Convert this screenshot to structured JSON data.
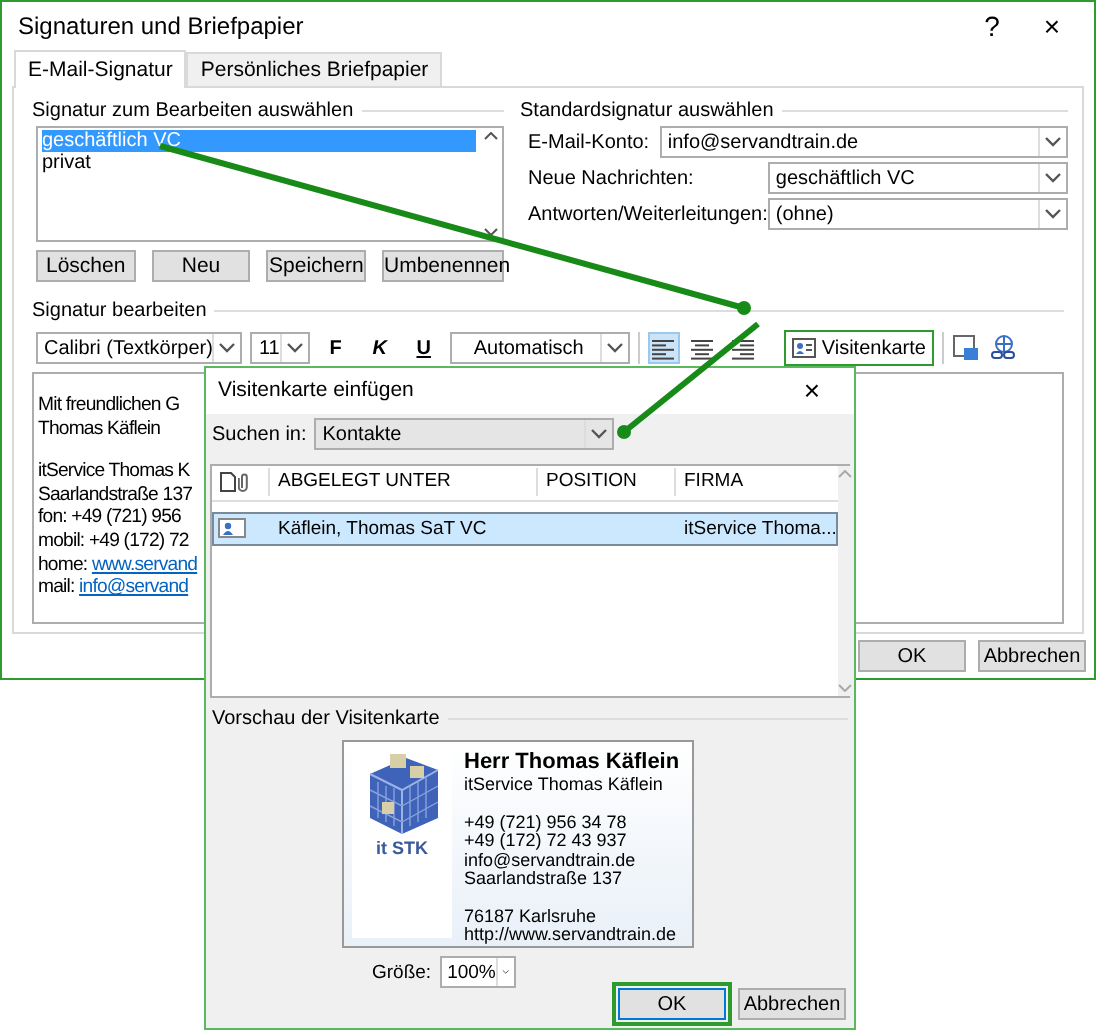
{
  "window": {
    "title": "Signaturen und Briefpapier",
    "help": "?",
    "close": "×"
  },
  "tabs": [
    {
      "label": "E-Mail-Signatur",
      "selected": true
    },
    {
      "label": "Persönliches Briefpapier",
      "selected": false
    }
  ],
  "signature_select": {
    "heading": "Signatur zum Bearbeiten auswählen",
    "items": [
      {
        "label": "geschäftlich VC",
        "selected": true
      },
      {
        "label": "privat",
        "selected": false
      }
    ],
    "buttons": [
      "Löschen",
      "Neu",
      "Speichern",
      "Umbenennen"
    ]
  },
  "default_signature": {
    "heading": "Standardsignatur auswählen",
    "fields": [
      {
        "label": "E-Mail-Konto:",
        "value": "info@servandtrain.de",
        "kind": "wide"
      },
      {
        "label": "Neue Nachrichten:",
        "value": "geschäftlich VC",
        "kind": "narrow"
      },
      {
        "label": "Antworten/Weiterleitungen:",
        "value": "(ohne)",
        "kind": "narrow"
      }
    ]
  },
  "editor": {
    "heading": "Signatur bearbeiten",
    "toolbar": {
      "font": "Calibri (Textkörper)",
      "size": "11",
      "bold": "F",
      "italic": "K",
      "underline": "U",
      "color_picker": "Automatisch",
      "alignment": [
        {
          "selected": true
        },
        {
          "selected": false
        },
        {
          "selected": false
        }
      ],
      "business_card_button": {
        "label": "Visitenkarte",
        "highlighted": true
      }
    },
    "lines": [
      {
        "kind": "gap"
      },
      {
        "kind": "text",
        "text": "Mit freundlichen G"
      },
      {
        "kind": "text",
        "text": "Thomas Käflein"
      },
      {
        "kind": "gap"
      },
      {
        "kind": "text",
        "text": "itService Thomas K"
      },
      {
        "kind": "text",
        "text": "Saarlandstraße 137"
      },
      {
        "kind": "text",
        "text": "fon: +49 (721) 956"
      },
      {
        "kind": "text",
        "text": "mobil: +49 (172) 72"
      },
      {
        "kind": "link",
        "label": "home:",
        "link": "www.servand"
      },
      {
        "kind": "link",
        "label": "mail:",
        "link": "info@servand"
      }
    ]
  },
  "buttons": [
    {
      "label": "OK"
    },
    {
      "label": "Abbrechen"
    }
  ],
  "card_dialog": {
    "title": "Visitenkarte einfügen",
    "close": "×",
    "search_label": "Suchen in:",
    "search_value": "Kontakte",
    "columns": [
      "ABGELEGT UNTER",
      "POSITION",
      "FIRMA"
    ],
    "rows": [
      {
        "filed_under": "Käflein, Thomas SaT VC",
        "company": "itService Thoma...",
        "selected": true
      }
    ],
    "preview_heading": "Vorschau der Visitenkarte",
    "card": {
      "logo_text": "it STK",
      "name": "Herr Thomas Käflein",
      "groups": [
        [
          "itService Thomas Käflein"
        ],
        [
          "+49 (721) 956 34 78",
          "+49 (172) 72 43 937",
          "info@servandtrain.de",
          "Saarlandstraße 137"
        ],
        [
          "76187  Karlsruhe",
          "http://www.servandtrain.de"
        ]
      ]
    },
    "size_label": "Größe:",
    "size_value": "100%",
    "buttons": [
      {
        "label": "OK",
        "highlighted": true
      },
      {
        "label": "Abbrechen",
        "highlighted": false
      }
    ]
  }
}
